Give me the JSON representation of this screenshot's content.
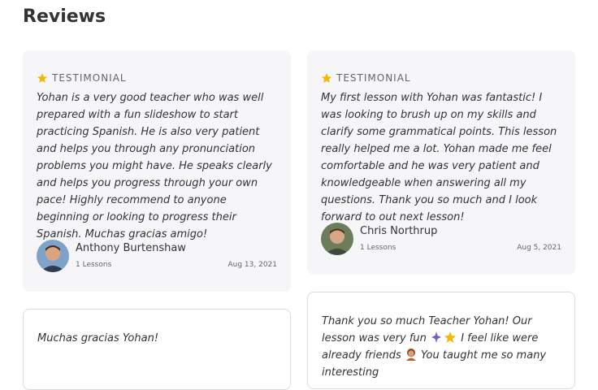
{
  "page": {
    "title": "Reviews"
  },
  "reviews": [
    {
      "label": "TESTIMONIAL",
      "text": "Yohan is a very good teacher who was well prepared with a fun slideshow to start practicing Spanish. He is also very patient and helps you through any pronunciation problems you might have. He speaks clearly and helps you progress through your own pace! Highly recommend to anyone beginning or looking to progress their Spanish. Muchas gracias amigo!",
      "author": "Anthony Burtenshaw",
      "lessons": "1 Lessons",
      "date": "Aug 13, 2021"
    },
    {
      "label": "TESTIMONIAL",
      "text": "My first lesson with Yohan was fantastic! I was looking to brush up on my skills and clarify some grammatical points. This lesson really helped me a lot. Yohan made me feel comfortable and he was very patient and knowledgeable when answering all my questions. Thank you so much and I look forward to out next lesson!",
      "author": "Chris Northrup",
      "lessons": "1 Lessons",
      "date": "Aug 5, 2021"
    },
    {
      "text": "Muchas gracias Yohan!"
    },
    {
      "text_a": "Thank you so much Teacher Yohan! Our lesson was very fun ",
      "text_b": " I feel like were already friends ",
      "text_c": " You taught me so many interesting"
    }
  ],
  "colors": {
    "star": "#f5b800",
    "card_bg": "#f6f6f9",
    "card_border": "#dcdcdc"
  },
  "icons": {
    "star": "star-icon",
    "avatar": "avatar",
    "sparkles": "sparkles-emoji",
    "person": "person-emoji"
  }
}
